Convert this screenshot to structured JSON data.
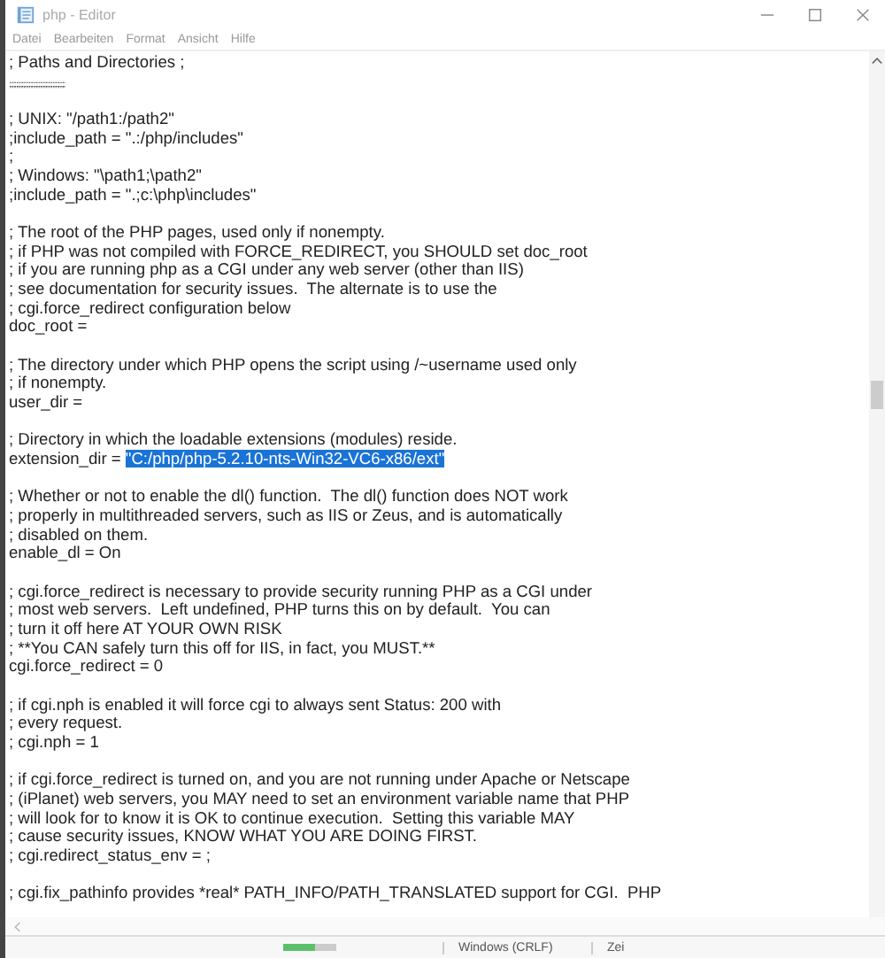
{
  "window": {
    "title": "php - Editor"
  },
  "menu": [
    "Datei",
    "Bearbeiten",
    "Format",
    "Ansicht",
    "Hilfe"
  ],
  "editor": {
    "blocks": [
      {
        "lines": [
          {
            "text": "; Paths and Directories ;"
          },
          {
            "text": ";;;;;;;;;;;;;;;;;;;;;;;;;;;;;;;;;;;;;;;;",
            "kind": "rule"
          }
        ]
      },
      {
        "lines": [
          {
            "text": "; UNIX: \"/path1:/path2\""
          },
          {
            "text": ";include_path = \".:/php/includes\""
          },
          {
            "text": ";"
          },
          {
            "text": "; Windows: \"\\path1;\\path2\""
          },
          {
            "text": ";include_path = \".;c:\\php\\includes\""
          }
        ]
      },
      {
        "lines": [
          {
            "text": "; The root of the PHP pages, used only if nonempty."
          },
          {
            "text": "; if PHP was not compiled with FORCE_REDIRECT, you SHOULD set doc_root"
          },
          {
            "text": "; if you are running php as a CGI under any web server (other than IIS)"
          },
          {
            "text": "; see documentation for security issues.  The alternate is to use the"
          },
          {
            "text": "; cgi.force_redirect configuration below"
          },
          {
            "text": "doc_root ="
          }
        ]
      },
      {
        "lines": [
          {
            "text": "; The directory under which PHP opens the script using /~username used only"
          },
          {
            "text": "; if nonempty."
          },
          {
            "text": "user_dir ="
          }
        ]
      },
      {
        "lines": [
          {
            "text": "; Directory in which the loadable extensions (modules) reside."
          },
          {
            "text": "extension_dir = ",
            "selection": "\"C:/php/php-5.2.10-nts-Win32-VC6-x86/ext\""
          }
        ]
      },
      {
        "lines": [
          {
            "text": "; Whether or not to enable the dl() function.  The dl() function does NOT work"
          },
          {
            "text": "; properly in multithreaded servers, such as IIS or Zeus, and is automatically"
          },
          {
            "text": "; disabled on them."
          },
          {
            "text": "enable_dl = On"
          }
        ]
      },
      {
        "lines": [
          {
            "text": "; cgi.force_redirect is necessary to provide security running PHP as a CGI under"
          },
          {
            "text": "; most web servers.  Left undefined, PHP turns this on by default.  You can"
          },
          {
            "text": "; turn it off here AT YOUR OWN RISK"
          },
          {
            "text": "; **You CAN safely turn this off for IIS, in fact, you MUST.**"
          },
          {
            "text": "cgi.force_redirect = 0"
          }
        ]
      },
      {
        "lines": [
          {
            "text": "; if cgi.nph is enabled it will force cgi to always sent Status: 200 with"
          },
          {
            "text": "; every request."
          },
          {
            "text": "; cgi.nph = 1"
          }
        ]
      },
      {
        "lines": [
          {
            "text": "; if cgi.force_redirect is turned on, and you are not running under Apache or Netscape"
          },
          {
            "text": "; (iPlanet) web servers, you MAY need to set an environment variable name that PHP"
          },
          {
            "text": "; will look for to know it is OK to continue execution.  Setting this variable MAY"
          },
          {
            "text": "; cause security issues, KNOW WHAT YOU ARE DOING FIRST."
          },
          {
            "text": "; cgi.redirect_status_env = ;"
          }
        ]
      },
      {
        "lines": [
          {
            "text": "; cgi.fix_pathinfo provides *real* PATH_INFO/PATH_TRANSLATED support for CGI.  PHP"
          }
        ]
      }
    ]
  },
  "status_bar": [
    "Windows (CRLF)",
    "Zei"
  ]
}
